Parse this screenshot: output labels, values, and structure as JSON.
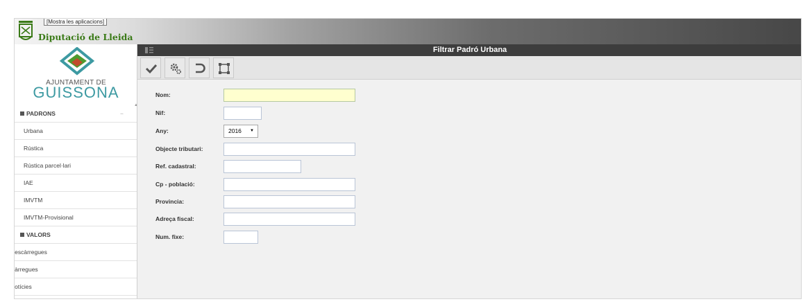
{
  "header": {
    "show_apps_label": "[Mostra les aplicacions]",
    "brand": "Diputació de Lleida",
    "brand_color": "#3a7a17"
  },
  "sidebar": {
    "logo": {
      "line1": "AJUNTAMENT DE",
      "line2": "GUISSONA",
      "accent_color": "#3d9aa2"
    },
    "sections": [
      {
        "label": "PADRONS",
        "items": [
          "Urbana",
          "Rústica",
          "Rústica parcel·lari",
          "IAE",
          "IMVTM",
          "IMVTM-Provisional"
        ]
      },
      {
        "label": "VALORS",
        "items": [
          "Descàrregues",
          "Càrregues",
          "Notícies"
        ]
      }
    ],
    "visible_cut_labels": [
      "Descàrregues",
      "Càrregues",
      "Notícies"
    ]
  },
  "main": {
    "title": "Filtrar Padró Urbana",
    "toolbar": {
      "buttons": [
        {
          "name": "accept",
          "icon": "check-icon"
        },
        {
          "name": "options",
          "icon": "gears-icon"
        },
        {
          "name": "back",
          "icon": "undo-icon"
        },
        {
          "name": "fullscreen",
          "icon": "expand-icon"
        }
      ]
    },
    "form": {
      "nom": {
        "label": "Nom:",
        "value": ""
      },
      "nif": {
        "label": "Nif:",
        "value": ""
      },
      "any": {
        "label": "Any:",
        "value": "2016"
      },
      "objecte": {
        "label": "Objecte tributari:",
        "value": ""
      },
      "ref_cadastral": {
        "label": "Ref. cadastral:",
        "value": ""
      },
      "cp_poblacio": {
        "label": "Cp - població:",
        "value": ""
      },
      "provincia": {
        "label": "Provincia:",
        "value": ""
      },
      "adreca": {
        "label": "Adreça fiscal:",
        "value": ""
      },
      "num_fixe": {
        "label": "Num. fixe:",
        "value": ""
      }
    }
  }
}
